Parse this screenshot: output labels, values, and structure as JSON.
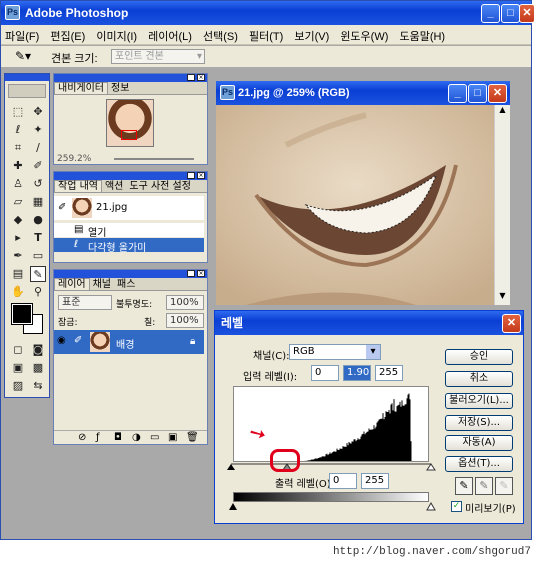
{
  "app": {
    "title": "Adobe Photoshop"
  },
  "menu": [
    "파일(F)",
    "편집(E)",
    "이미지(I)",
    "레이어(L)",
    "선택(S)",
    "필터(T)",
    "보기(V)",
    "윈도우(W)",
    "도움말(H)"
  ],
  "options": {
    "brush_label": "견본 크기:",
    "brush_value": "포인트 견본"
  },
  "navigator": {
    "tabs": [
      "내비게이터",
      "정보"
    ],
    "zoom": "259.2%"
  },
  "history": {
    "tabs": [
      "작업 내역",
      "액션",
      "도구 사전 설정"
    ],
    "snapshot": "21.jpg",
    "items": [
      "열기",
      "다각형 올가미"
    ]
  },
  "layers": {
    "tabs": [
      "레이어",
      "채널",
      "패스"
    ],
    "mode": "표준",
    "opacity_label": "불투명도:",
    "opacity": "100%",
    "lock_label": "잠금:",
    "fill_label": "칠:",
    "fill": "100%",
    "layer_name": "배경"
  },
  "document": {
    "title": "21.jpg @ 259% (RGB)"
  },
  "levels": {
    "title": "레벨",
    "channel_label": "채널(C):",
    "channel": "RGB",
    "input_label": "입력 레벨(I):",
    "input": [
      "0",
      "1.90",
      "255"
    ],
    "output_label": "출력 레벨(O):",
    "output": [
      "0",
      "255"
    ],
    "buttons": [
      "승인",
      "취소",
      "불러오기(L)...",
      "저장(S)...",
      "자동(A)",
      "옵션(T)..."
    ],
    "preview_label": "미리보기(P)",
    "preview_checked": true
  },
  "footer": {
    "url": "http://blog.naver.com/shgorud7"
  },
  "colors": {
    "title_blue": "#0a3fd4",
    "close_red": "#c33a1c",
    "annotation": "#e0001b"
  }
}
